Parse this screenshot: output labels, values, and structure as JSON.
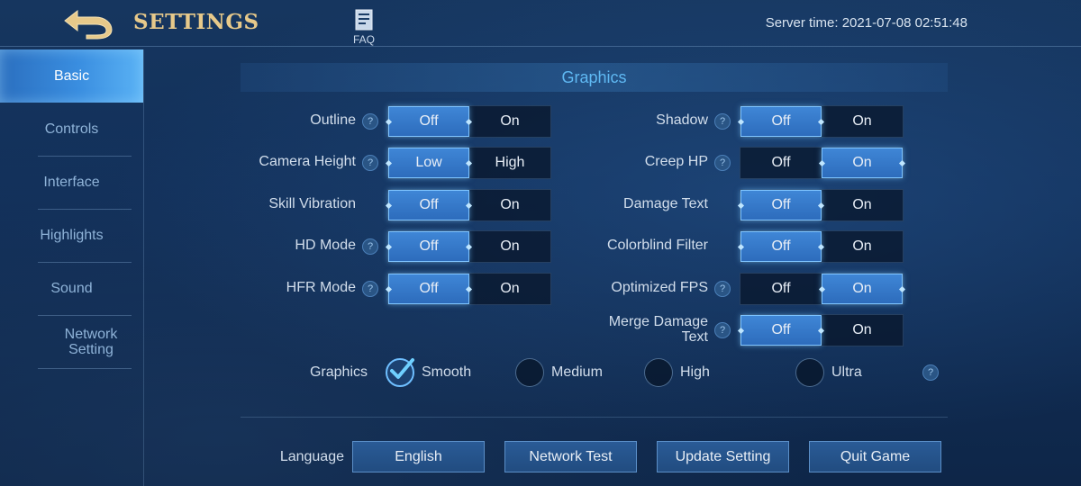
{
  "header": {
    "title": "SETTINGS",
    "faq_label": "FAQ",
    "server_time": "Server time: 2021-07-08 02:51:48"
  },
  "sidebar": {
    "items": [
      {
        "label": "Basic",
        "active": true
      },
      {
        "label": "Controls"
      },
      {
        "label": "Interface"
      },
      {
        "label": "Highlights"
      },
      {
        "label": "Sound"
      },
      {
        "label": "Network Setting"
      }
    ]
  },
  "section": {
    "title": "Graphics"
  },
  "settings_left": [
    {
      "label": "Outline",
      "help": true,
      "options": [
        "Off",
        "On"
      ],
      "selected": "Off"
    },
    {
      "label": "Camera Height",
      "help": true,
      "options": [
        "Low",
        "High"
      ],
      "selected": "Low"
    },
    {
      "label": "Skill Vibration",
      "help": false,
      "options": [
        "Off",
        "On"
      ],
      "selected": "Off"
    },
    {
      "label": "HD Mode",
      "help": true,
      "options": [
        "Off",
        "On"
      ],
      "selected": "Off"
    },
    {
      "label": "HFR Mode",
      "help": true,
      "options": [
        "Off",
        "On"
      ],
      "selected": "Off"
    }
  ],
  "settings_right": [
    {
      "label": "Shadow",
      "help": true,
      "options": [
        "Off",
        "On"
      ],
      "selected": "Off"
    },
    {
      "label": "Creep HP",
      "help": true,
      "options": [
        "Off",
        "On"
      ],
      "selected": "On"
    },
    {
      "label": "Damage Text",
      "help": false,
      "options": [
        "Off",
        "On"
      ],
      "selected": "Off"
    },
    {
      "label": "Colorblind Filter",
      "help": false,
      "options": [
        "Off",
        "On"
      ],
      "selected": "Off"
    },
    {
      "label": "Optimized FPS",
      "help": true,
      "options": [
        "Off",
        "On"
      ],
      "selected": "On"
    },
    {
      "label": "Merge Damage Text",
      "help": true,
      "options": [
        "Off",
        "On"
      ],
      "selected": "Off"
    }
  ],
  "graphics_quality": {
    "label": "Graphics",
    "options": [
      "Smooth",
      "Medium",
      "High",
      "Ultra"
    ],
    "selected": "Smooth",
    "help_glyph": "?"
  },
  "footer": {
    "language_label": "Language",
    "language_value": "English",
    "network_test": "Network Test",
    "update_setting": "Update Setting",
    "quit_game": "Quit Game"
  },
  "colors": {
    "accent": "#3f86d6",
    "title_gold": "#e7c98a",
    "section_blue": "#5fb8f2"
  },
  "icons": {
    "back": "back-arrow-icon",
    "faq": "document-icon",
    "help": "question-icon",
    "check": "checkmark-icon"
  }
}
